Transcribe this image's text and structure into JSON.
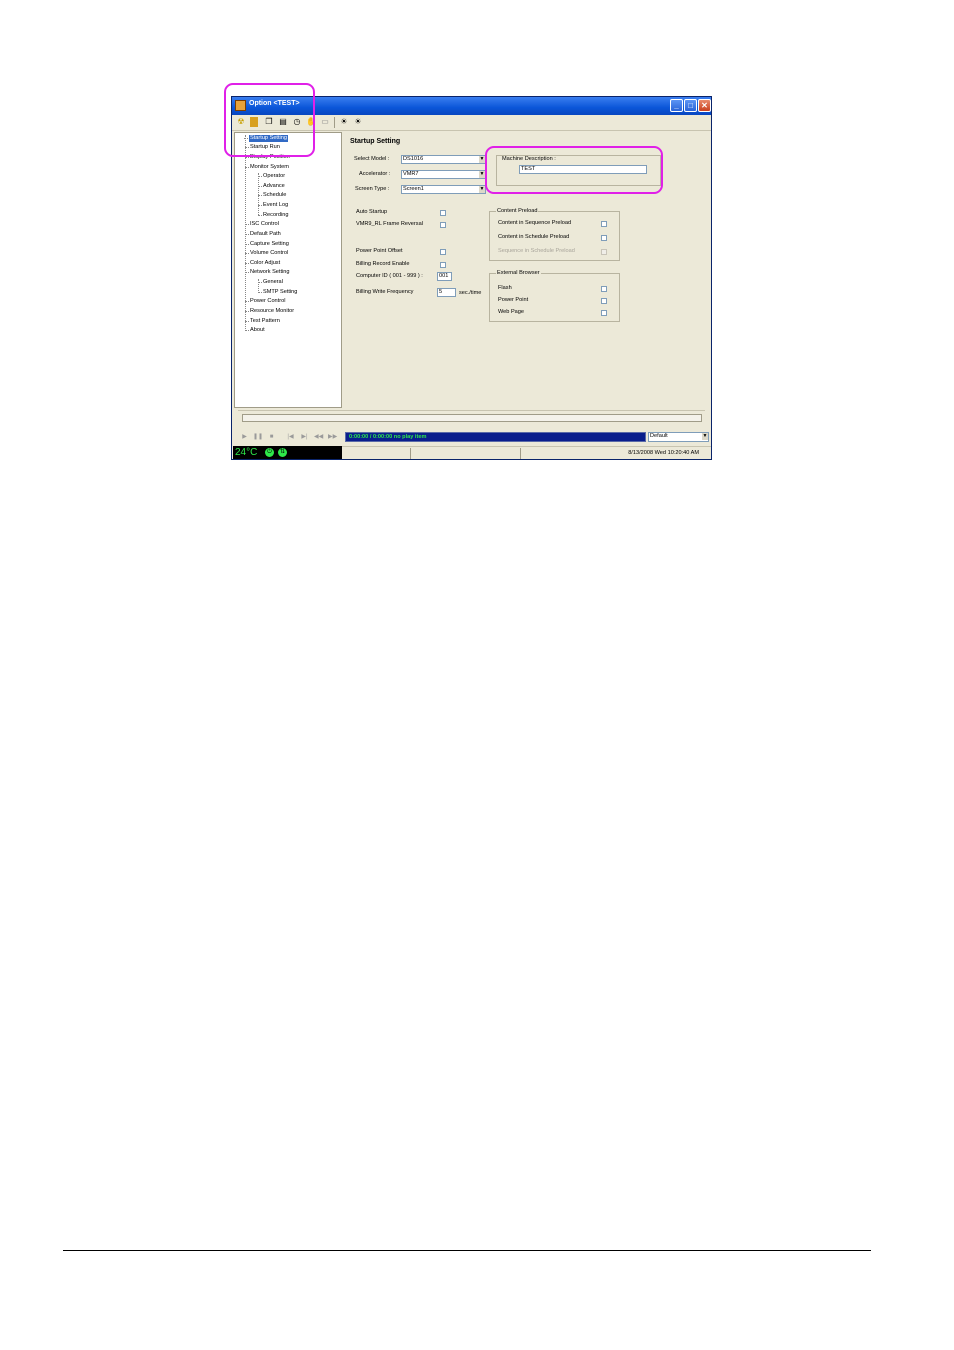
{
  "window": {
    "title": "Option <TEST>",
    "buttons": {
      "minimize": "_",
      "maximize": "□",
      "close": "✕"
    }
  },
  "toolbar": {
    "icons": [
      "radiation-icon",
      "folder-icon",
      "copy-icon",
      "save-icon",
      "clock-icon",
      "hand-icon",
      "keyboard-icon",
      "sun-icon",
      "sun-icon"
    ]
  },
  "tree": {
    "items": [
      {
        "label": "Startup Setting",
        "level": 0,
        "selected": true
      },
      {
        "label": "Startup Run",
        "level": 0
      },
      {
        "label": "Display Position",
        "level": 0
      },
      {
        "label": "Monitor System",
        "level": 0
      },
      {
        "label": "Operator",
        "level": 1
      },
      {
        "label": "Advance",
        "level": 1
      },
      {
        "label": "Schedule",
        "level": 1
      },
      {
        "label": "Event Log",
        "level": 1
      },
      {
        "label": "Recording",
        "level": 1
      },
      {
        "label": "ISC Control",
        "level": 0
      },
      {
        "label": "Default Path",
        "level": 0
      },
      {
        "label": "Capture Setting",
        "level": 0
      },
      {
        "label": "Volume Control",
        "level": 0
      },
      {
        "label": "Color Adjust",
        "level": 0
      },
      {
        "label": "Network Setting",
        "level": 0
      },
      {
        "label": "General",
        "level": 1
      },
      {
        "label": "SMTP Setting",
        "level": 1
      },
      {
        "label": "Power Control",
        "level": 0
      },
      {
        "label": "Resource Monitor",
        "level": 0
      },
      {
        "label": "Test Pattern",
        "level": 0
      },
      {
        "label": "About",
        "level": 0
      }
    ]
  },
  "panel": {
    "heading": "Startup Setting",
    "select_model_label": "Select Model :",
    "select_model_value": "DS1016",
    "accelerator_label": "Accelerator :",
    "accelerator_value": "VMR7",
    "screen_type_label": "Screen Type :",
    "screen_type_value": "Screen1",
    "machine_desc_label": "Machine Description :",
    "machine_desc_value": "TEST",
    "auto_startup": "Auto Startup",
    "vmr9_reversal": "VMR9_RL Frame Reversal",
    "power_point_offset": "Power Point Offset",
    "billing_record": "Billing Record Enable",
    "computer_id_label": "Computer ID ( 001 - 999 ) :",
    "computer_id_value": "001",
    "billing_freq_label": "Billing Write Frequency",
    "billing_freq_value": "5",
    "billing_freq_unit": "sec./time",
    "content_preload": {
      "title": "Content Preload",
      "items": [
        "Content in Sequence Preload",
        "Content in Schedule Preload",
        "Sequence in Schedule Preload"
      ]
    },
    "external_browser": {
      "title": "External Browser",
      "items": [
        "Flash",
        "Power Point",
        "Web Page"
      ]
    }
  },
  "player": {
    "controls": [
      "▶",
      "❚❚",
      "■",
      "|◀",
      "▶|",
      "◀◀",
      "▶▶"
    ],
    "time_text": "0:00:00 / 0:00:00  no play item",
    "default_combo": "Default",
    "temperature": "24°C",
    "status_date": "8/13/2008 Wed 10:20:40 AM"
  }
}
